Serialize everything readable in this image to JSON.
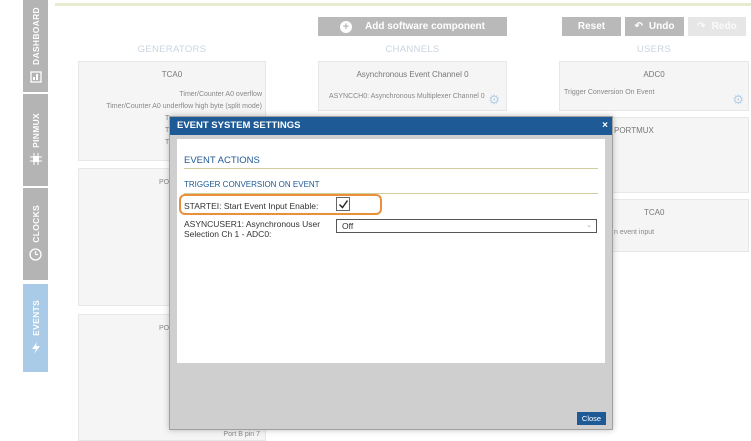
{
  "sidebar": {
    "items": [
      {
        "label": "DASHBOARD",
        "icon": "dashboard-icon"
      },
      {
        "label": "PINMUX",
        "icon": "chip-icon"
      },
      {
        "label": "CLOCKS",
        "icon": "clock-icon"
      },
      {
        "label": "EVENTS",
        "icon": "lightning-icon"
      }
    ]
  },
  "toolbar": {
    "add_label": "Add software component",
    "reset_label": "Reset",
    "undo_label": "Undo",
    "redo_label": "Redo"
  },
  "columns": {
    "generators": "GENERATORS",
    "channels": "CHANNELS",
    "users": "USERS"
  },
  "generators": {
    "tca0_title": "TCA0",
    "tca0_line1": "Timer/Counter A0 overflow",
    "tca0_line2": "Timer/Counter A0 underflow high byte (split mode)",
    "partial_t1": "T",
    "partial_t2": "T",
    "partial_t3": "T",
    "card2_partial": "PO",
    "card3_partial": "PO",
    "card3_bottom": "Port B pin 7"
  },
  "channels": {
    "title": "Asynchronous Event Channel 0",
    "text": "ASYNCCH0: Asynchronous Multiplexer Channel 0"
  },
  "users": {
    "adc0_title": "ADC0",
    "adc0_text": "Trigger Conversion On Event",
    "portmux_title": "PORTMUX",
    "tca0_title": "TCA0",
    "tca0_text": "n event input"
  },
  "modal": {
    "title": "EVENT SYSTEM SETTINGS",
    "close_x": "×",
    "section_title": "EVENT ACTIONS",
    "subsection_title": "TRIGGER CONVERSION ON EVENT",
    "field1_label": "STARTEI: Start Event Input Enable:",
    "field1_checked": true,
    "field2_label_line1": "ASYNCUSER1: Asynchronous User",
    "field2_label_line2": "Selection Ch 1 - ADC0:",
    "field2_value": "Off",
    "close_button": "Close"
  },
  "colors": {
    "header_blue": "#1e5a96",
    "highlight_orange": "#e8903c",
    "active_tab": "#a9cbe7"
  }
}
